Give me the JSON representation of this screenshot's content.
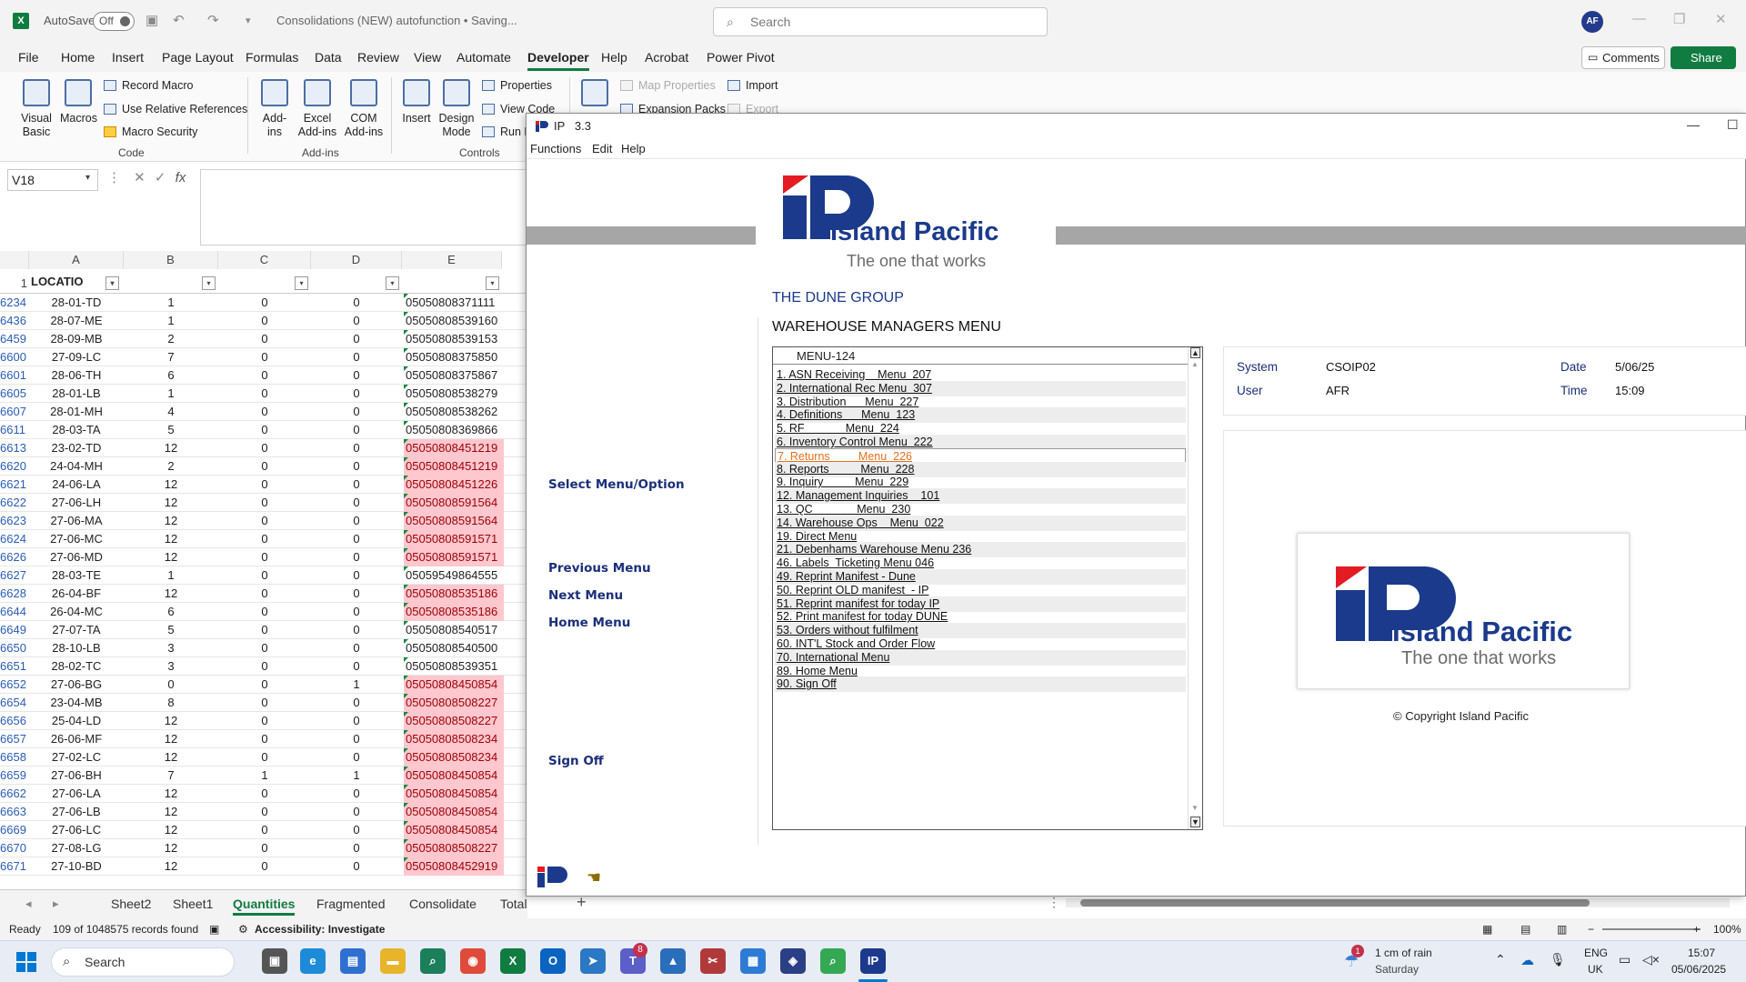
{
  "excel": {
    "title_bar": {
      "autosave_label": "AutoSave",
      "autosave_state": "Off",
      "document_title": "Consolidations (NEW) autofunction • Saving...",
      "search_placeholder": "Search",
      "avatar_initials": "AF"
    },
    "menu_tabs": [
      "File",
      "Home",
      "Insert",
      "Page Layout",
      "Formulas",
      "Data",
      "Review",
      "View",
      "Automate",
      "Developer",
      "Help",
      "Acrobat",
      "Power Pivot"
    ],
    "active_tab": "Developer",
    "comments_label": "Comments",
    "share_label": "Share",
    "ribbon": {
      "visual_basic": "Visual Basic",
      "macros": "Macros",
      "record_macro": "Record Macro",
      "use_relative": "Use Relative References",
      "macro_security": "Macro Security",
      "group_code": "Code",
      "add_ins": "Add-ins",
      "excel_add_ins": "Excel Add-ins",
      "com_add_ins": "COM Add-ins",
      "group_addins": "Add-ins",
      "insert": "Insert",
      "design_mode": "Design Mode",
      "properties": "Properties",
      "view_code": "View Code",
      "run_dialog": "Run D",
      "group_controls": "Controls",
      "map_properties": "Map Properties",
      "expansion_packs": "Expansion Packs",
      "import": "Import",
      "export": "Export"
    },
    "name_box": "V18",
    "columns": [
      "A",
      "B",
      "C",
      "D",
      "E"
    ],
    "header_row_number": "1",
    "header_a": "LOCATIO",
    "rows": [
      [
        "6234",
        "28-01-TD",
        "1",
        "0",
        "0",
        "05050808371111",
        false
      ],
      [
        "6436",
        "28-07-ME",
        "1",
        "0",
        "0",
        "05050808539160",
        false
      ],
      [
        "6459",
        "28-09-MB",
        "2",
        "0",
        "0",
        "05050808539153",
        false
      ],
      [
        "6600",
        "27-09-LC",
        "7",
        "0",
        "0",
        "05050808375850",
        false
      ],
      [
        "6601",
        "28-06-TH",
        "6",
        "0",
        "0",
        "05050808375867",
        false
      ],
      [
        "6605",
        "28-01-LB",
        "1",
        "0",
        "0",
        "05050808538279",
        false
      ],
      [
        "6607",
        "28-01-MH",
        "4",
        "0",
        "0",
        "05050808538262",
        false
      ],
      [
        "6611",
        "28-03-TA",
        "5",
        "0",
        "0",
        "05050808369866",
        false
      ],
      [
        "6613",
        "23-02-TD",
        "12",
        "0",
        "0",
        "05050808451219",
        true
      ],
      [
        "6620",
        "24-04-MH",
        "2",
        "0",
        "0",
        "05050808451219",
        true
      ],
      [
        "6621",
        "24-06-LA",
        "12",
        "0",
        "0",
        "05050808451226",
        true
      ],
      [
        "6622",
        "27-06-LH",
        "12",
        "0",
        "0",
        "05050808591564",
        true
      ],
      [
        "6623",
        "27-06-MA",
        "12",
        "0",
        "0",
        "05050808591564",
        true
      ],
      [
        "6624",
        "27-06-MC",
        "12",
        "0",
        "0",
        "05050808591571",
        true
      ],
      [
        "6626",
        "27-06-MD",
        "12",
        "0",
        "0",
        "05050808591571",
        true
      ],
      [
        "6627",
        "28-03-TE",
        "1",
        "0",
        "0",
        "05059549864555",
        false
      ],
      [
        "6628",
        "26-04-BF",
        "12",
        "0",
        "0",
        "05050808535186",
        true
      ],
      [
        "6644",
        "26-04-MC",
        "6",
        "0",
        "0",
        "05050808535186",
        true
      ],
      [
        "6649",
        "27-07-TA",
        "5",
        "0",
        "0",
        "05050808540517",
        false
      ],
      [
        "6650",
        "28-10-LB",
        "3",
        "0",
        "0",
        "05050808540500",
        false
      ],
      [
        "6651",
        "28-02-TC",
        "3",
        "0",
        "0",
        "05050808539351",
        false
      ],
      [
        "6652",
        "27-06-BG",
        "0",
        "0",
        "1",
        "05050808450854",
        true
      ],
      [
        "6654",
        "23-04-MB",
        "8",
        "0",
        "0",
        "05050808508227",
        true
      ],
      [
        "6656",
        "25-04-LD",
        "12",
        "0",
        "0",
        "05050808508227",
        true
      ],
      [
        "6657",
        "26-06-MF",
        "12",
        "0",
        "0",
        "05050808508234",
        true
      ],
      [
        "6658",
        "27-02-LC",
        "12",
        "0",
        "0",
        "05050808508234",
        true
      ],
      [
        "6659",
        "27-06-BH",
        "7",
        "1",
        "1",
        "05050808450854",
        true
      ],
      [
        "6662",
        "27-06-LA",
        "12",
        "0",
        "0",
        "05050808450854",
        true
      ],
      [
        "6663",
        "27-06-LB",
        "12",
        "0",
        "0",
        "05050808450854",
        true
      ],
      [
        "6669",
        "27-06-LC",
        "12",
        "0",
        "0",
        "05050808450854",
        true
      ],
      [
        "6670",
        "27-08-LG",
        "12",
        "0",
        "0",
        "05050808508227",
        true
      ],
      [
        "6671",
        "27-10-BD",
        "12",
        "0",
        "0",
        "05050808452919",
        true
      ]
    ],
    "sheet_tabs": [
      "Sheet2",
      "Sheet1",
      "Quantities",
      "Fragmented",
      "Consolidate",
      "Total"
    ],
    "active_sheet": "Quantities",
    "status": {
      "ready": "Ready",
      "records": "109 of 1048575 records found",
      "accessibility": "Accessibility: Investigate",
      "zoom": "100%"
    }
  },
  "ip_window": {
    "title": "IP   3.3",
    "menus": [
      "Functions",
      "Edit",
      "Help"
    ],
    "logo_word": "Island Pacific",
    "logo_tagline": "The one that works",
    "company": "THE DUNE GROUP",
    "menu_title": "WAREHOUSE MANAGERS MENU",
    "menu_code": "MENU-124",
    "commands": {
      "select": "Select Menu/Option",
      "previous": "Previous Menu",
      "next": "Next Menu",
      "home": "Home Menu",
      "signoff": "Sign Off"
    },
    "menu_items": [
      "1. ASN Receiving    Menu  207",
      "2. International Rec Menu  307",
      "3. Distribution      Menu  227",
      "4. Definitions      Menu  123",
      "5. RF             Menu  224",
      "6. Inventory Control Menu  222",
      "7. Returns         Menu  226",
      "8. Reports          Menu  228",
      "9. Inquiry          Menu  229",
      "12. Management Inquiries    101",
      "13. QC              Menu  230",
      "14. Warehouse Ops    Menu  022",
      "19. Direct Menu",
      "21. Debenhams Warehouse Menu 236",
      "46. Labels  Ticketing Menu 046",
      "49. Reprint Manifest - Dune",
      "50. Reprint OLD manifest  - IP",
      "51. Reprint manifest for today IP",
      "52. Print manifest for today DUNE",
      "53. Orders without fulfilment",
      "60. INT'L Stock and Order Flow",
      "70. International Menu",
      "89. Home Menu",
      "90. Sign Off"
    ],
    "selected_index": 6,
    "info": {
      "system_label": "System",
      "system_value": "CSOIP02",
      "date_label": "Date",
      "date_value": "5/06/25",
      "user_label": "User",
      "user_value": "AFR",
      "time_label": "Time",
      "time_value": "15:09"
    },
    "copyright": "© Copyright Island Pacific"
  },
  "taskbar": {
    "search": "Search",
    "weather_temp": "1 cm of rain",
    "weather_day": "Saturday",
    "lang1": "ENG",
    "lang2": "UK",
    "time": "15:07",
    "date": "05/06/2025",
    "teams_badge": "8",
    "weather_badge": "1"
  },
  "colors": {
    "excel_green": "#107c41",
    "ip_blue": "#1b3a8c",
    "ip_red": "#e31b23",
    "highlight_pink": "#ffc7ce",
    "selected_orange": "#e4701e"
  }
}
